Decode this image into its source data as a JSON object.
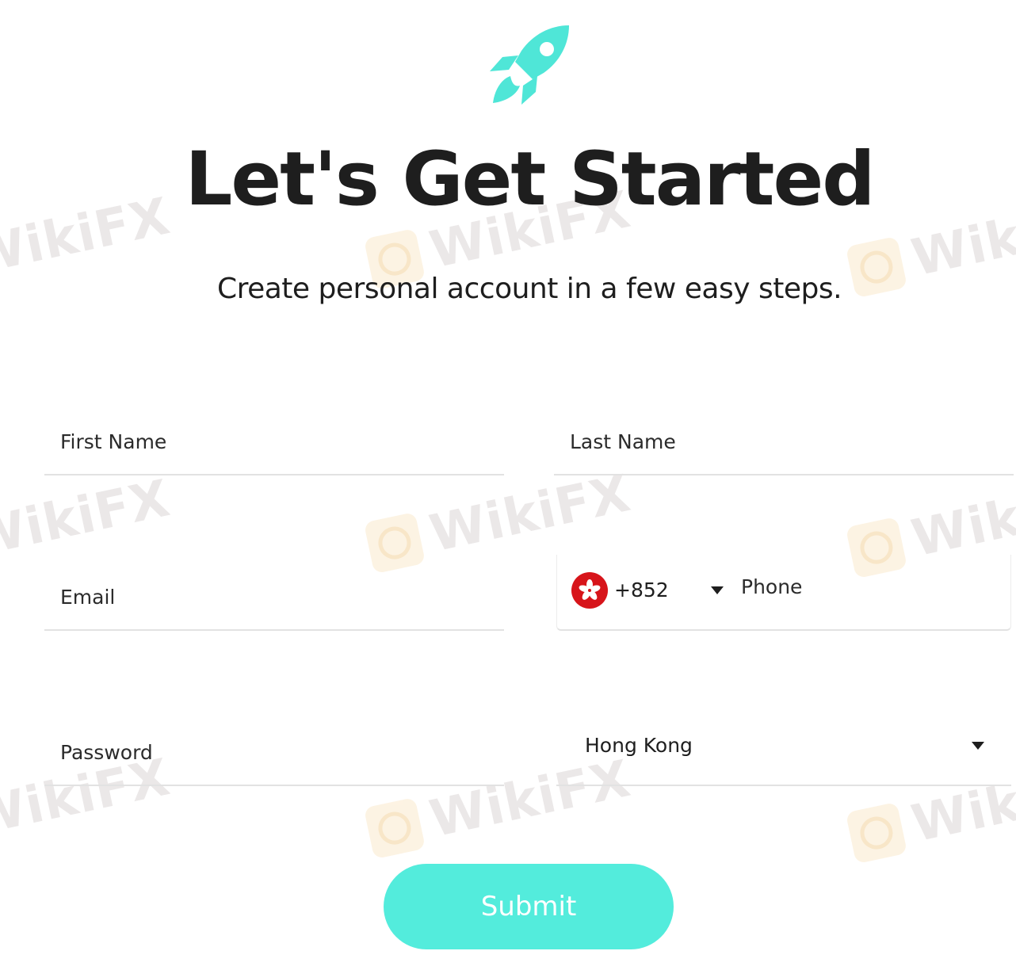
{
  "header": {
    "title": "Let's Get Started",
    "subtitle": "Create personal account in a few easy steps.",
    "icon": "rocket-icon"
  },
  "form": {
    "first_name": {
      "placeholder": "First Name",
      "value": ""
    },
    "last_name": {
      "placeholder": "Last Name",
      "value": ""
    },
    "email": {
      "placeholder": "Email",
      "value": ""
    },
    "phone": {
      "flag_icon": "hong-kong-flag-icon",
      "dial_code": "+852",
      "placeholder": "Phone",
      "value": ""
    },
    "password": {
      "placeholder": "Password",
      "value": ""
    },
    "country": {
      "selected": "Hong Kong"
    },
    "submit_label": "Submit"
  },
  "watermark": {
    "text": "WikiFX"
  },
  "colors": {
    "accent": "#53ecdc",
    "rocket": "#4fe6d7",
    "text": "#1e1e1e",
    "flag_red": "#d7141a",
    "divider": "#e2e2e2"
  }
}
